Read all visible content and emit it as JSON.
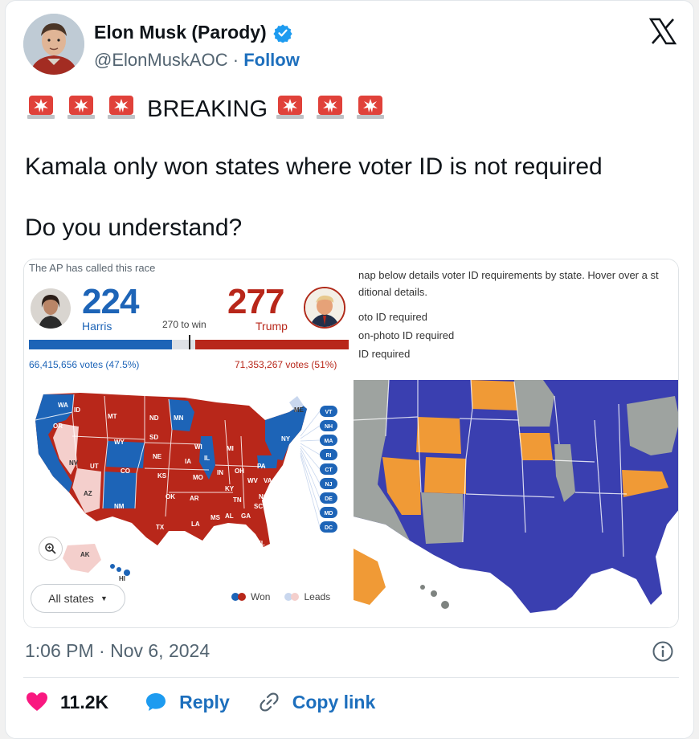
{
  "author": {
    "name": "Elon Musk (Parody)",
    "handle": "@ElonMuskAOC",
    "separator": "·",
    "follow_label": "Follow",
    "verified_color": "#1d9bf0"
  },
  "tweet": {
    "breaking_word": "BREAKING",
    "line2": "Kamala only won states where voter ID is not required",
    "line3": "Do you understand?",
    "siren_icon": "police-siren-emoji"
  },
  "media_left": {
    "ap_label": "The AP has called this race",
    "harris_ev": "224",
    "harris_name": "Harris",
    "trump_ev": "277",
    "trump_name": "Trump",
    "to_win": "270 to win",
    "harris_votes": "66,415,656 votes (47.5%)",
    "trump_votes": "71,353,267 votes (51%)",
    "harris_share": 0.447,
    "trump_share": 0.479,
    "all_states_label": "All states",
    "legend_won": "Won",
    "legend_leads": "Leads",
    "small_states": [
      "VT",
      "NH",
      "MA",
      "RI",
      "CT",
      "NJ",
      "DE",
      "MD",
      "DC"
    ],
    "colors": {
      "dem": "#1d64b7",
      "rep": "#b8271a",
      "dem_lead": "#c9d7ee",
      "rep_lead": "#f4cfcc"
    }
  },
  "media_right": {
    "line1": "nap below details voter ID requirements by state. Hover over a st",
    "line2": "ditional details.",
    "legend1": "oto ID required",
    "legend2": "on-photo ID required",
    "legend3": "ID required",
    "colors": {
      "no_id": "#3a3fb0",
      "photo": "#f09a36",
      "non_photo": "#9ea3a0"
    }
  },
  "footer": {
    "timestamp": "1:06 PM · Nov 6, 2024",
    "likes": "11.2K",
    "reply_label": "Reply",
    "copy_label": "Copy link"
  }
}
